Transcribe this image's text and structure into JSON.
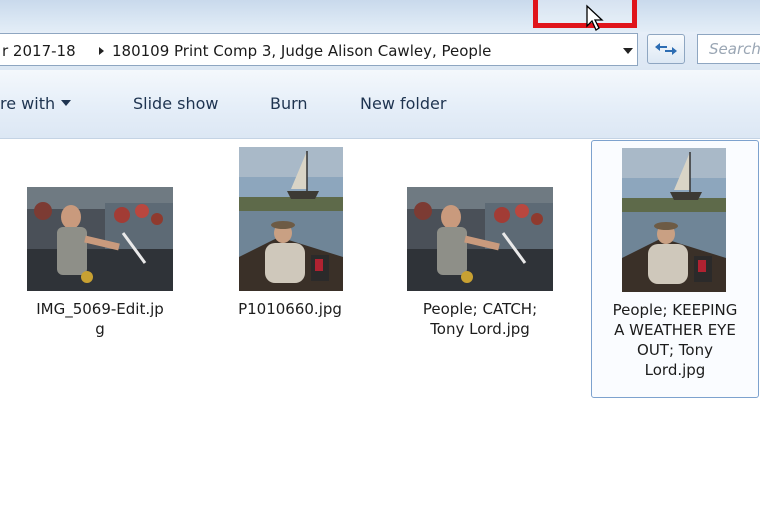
{
  "address_bar": {
    "crumbs": [
      "r 2017-18",
      "180109 Print Comp 3, Judge Alison Cawley, People"
    ],
    "search_placeholder": "Search"
  },
  "toolbar": {
    "items": [
      {
        "label": "re with",
        "has_dropdown": true
      },
      {
        "label": "Slide show"
      },
      {
        "label": "Burn"
      },
      {
        "label": "New folder"
      }
    ]
  },
  "files": [
    {
      "name": "IMG_5069-Edit.jp\ng",
      "thumbnail": "man-throwing-knife-photo",
      "selected": false
    },
    {
      "name": "P1010660.jpg",
      "thumbnail": "man-in-boat-with-sailboat-photo",
      "selected": false
    },
    {
      "name": "People; CATCH;\nTony Lord.jpg",
      "thumbnail": "man-throwing-knife-photo",
      "selected": false
    },
    {
      "name": "People; KEEPING\nA WEATHER EYE\nOUT; Tony\nLord.jpg",
      "thumbnail": "man-in-boat-with-sailboat-photo",
      "selected": true
    }
  ],
  "colors": {
    "highlight_border": "#e0141b",
    "toolbar_text": "#1e3450",
    "selection_border": "#7da2ce"
  }
}
